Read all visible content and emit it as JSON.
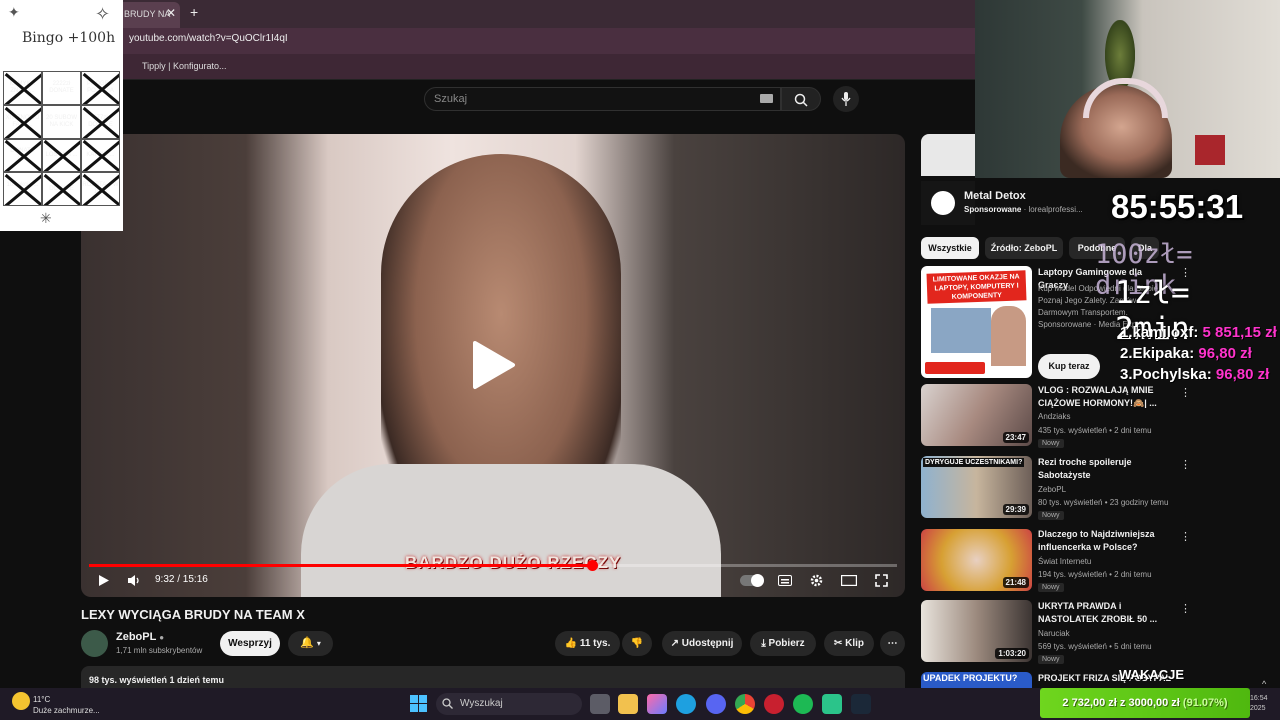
{
  "browser": {
    "tab_title": "BRUDY NA",
    "tab_close": "✕",
    "new_tab": "+",
    "url": "youtube.com/watch?v=QuOClr1I4qI",
    "bookmark": "Tipply | Konfigurato..."
  },
  "youtube": {
    "search_placeholder": "Szukaj",
    "player": {
      "caption": "BARDZO DUŻO RZECZY",
      "time": "9:32 / 15:16",
      "progress_fraction": 0.622
    },
    "video": {
      "title": "LEXY WYCIĄGA BRUDY NA TEAM X",
      "channel": "ZeboPL",
      "subscribers": "1,71 mln subskrybentów",
      "support_label": "Wesprzyj",
      "likes": "11 tys.",
      "share_label": "Udostępnij",
      "download_label": "Pobierz",
      "clip_label": "Klip",
      "more_label": "⋯",
      "views_date": "98 tys. wyświetleń  1 dzień temu"
    },
    "sidebar": {
      "ad_title": "Metal Detox",
      "ad_sponsor": "Sponsorowane",
      "ad_domain": "lorealprofessi...",
      "chips": [
        "Wszystkie",
        "Źródło: ZeboPL",
        "Podobne",
        "Dla"
      ],
      "items": [
        {
          "title": "Laptopy Gamingowe dla Graczy",
          "meta": "Kup Model Odpowiedni dla Siebie. Poznaj Jego Zalety. Zamów z Darmowym Transportem.",
          "channel": "Sponsorowane · Media Expert",
          "cta": "Kup teraz",
          "thumb_text": "LIMITOWANE OKAZJE NA LAPTOPY, KOMPUTERY I KOMPONENTY"
        },
        {
          "title": "VLOG : ROZWALAJĄ MNIE CIĄŻOWE HORMONY!🙈| ...",
          "channel": "Andziaks",
          "stats": "435 tys. wyświetleń • 2 dni temu",
          "badge": "Nowy",
          "duration": "23:47"
        },
        {
          "title": "Rezi troche spoileruje Sabotażyste",
          "channel": "ZeboPL",
          "stats": "80 tys. wyświetleń • 23 godziny temu",
          "badge": "Nowy",
          "duration": "29:39",
          "thumb_text": "DYRYGUJE UCZESTNIKAMI?"
        },
        {
          "title": "Dlaczego to Najdziwniejsza influencerka w Polsce?",
          "channel": "Świat Internetu",
          "stats": "194 tys. wyświetleń • 2 dni temu",
          "badge": "Nowy",
          "duration": "21:48"
        },
        {
          "title": "UKRYTA PRAWDA i NASTOLATEK ZROBIŁ 50 ...",
          "channel": "Naruciak",
          "stats": "569 tys. wyświetleń • 5 dni temu",
          "badge": "Nowy",
          "duration": "1:03:20"
        },
        {
          "title": "PROJEKT FRIZA SIĘ POSYPAŁ",
          "thumb_text": "UPADEK PROJEKTU?"
        }
      ]
    }
  },
  "stream_overlay": {
    "timer": "85:55:31",
    "rule1": "100zł= drink",
    "rule2": "1zł= 2min",
    "donors": [
      {
        "rank": "1.",
        "name": "kamiloxf:",
        "amount": "5 851,15 zł"
      },
      {
        "rank": "2.",
        "name": "Ekipaka:",
        "amount": "96,80 zł"
      },
      {
        "rank": "3.",
        "name": "Pochylska:",
        "amount": "96,80 zł"
      }
    ],
    "wakacje": "WAKACJE",
    "goal_current": "2 732,00 zł",
    "goal_sep": "z",
    "goal_target": "3000,00 zł",
    "goal_percent": "(91.07%)",
    "bingo_title": "Bingo +100h",
    "bingo_cells": [
      {
        "text": "KAMYK... ZNAJD...",
        "crossed": true
      },
      {
        "text": "2222zł DONATE",
        "crossed": false
      },
      {
        "text": "PROGR... POJAWIA",
        "crossed": true
      },
      {
        "text": "XIV ZNOWU FAKE...",
        "crossed": true
      },
      {
        "text": "20 SUBOW NA KICK",
        "crossed": false
      },
      {
        "text": "177zł DONATE",
        "crossed": true
      },
      {
        "text": "DONATE 77...",
        "crossed": true
      },
      {
        "text": "LOST NA ...",
        "crossed": true
      },
      {
        "text": "KATRIN ...",
        "crossed": true
      },
      {
        "text": "10x akcja ... 5zł",
        "crossed": true
      },
      {
        "text": "DONATE",
        "crossed": true
      },
      {
        "text": "ROZSTA... W 100h",
        "crossed": true
      }
    ]
  },
  "taskbar": {
    "temperature": "11°C",
    "weather": "Duże zachmurze...",
    "search": "Wyszukaj",
    "time": "16:54",
    "date": "2025"
  }
}
